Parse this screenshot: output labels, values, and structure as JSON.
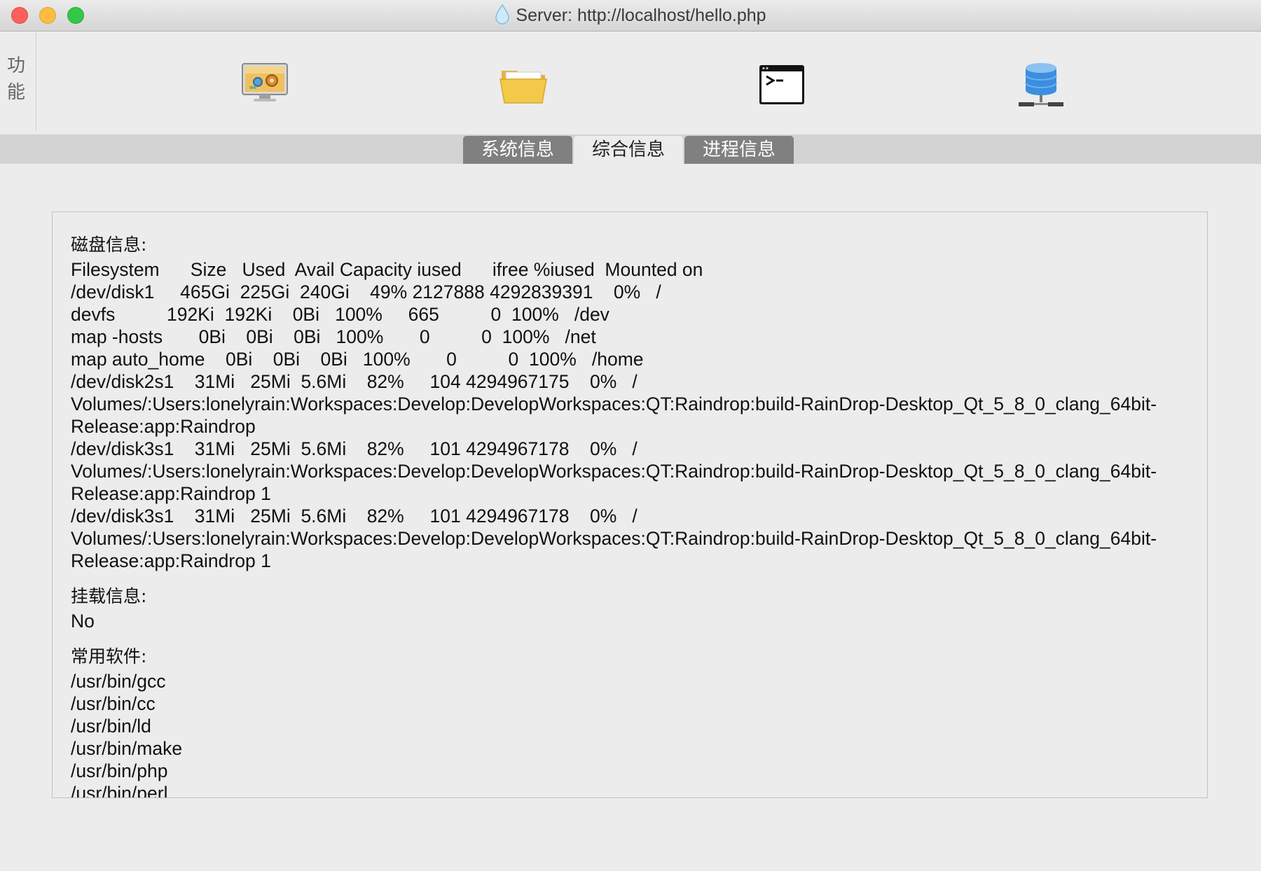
{
  "window": {
    "title": "Server: http://localhost/hello.php"
  },
  "toolbar": {
    "side_label": "功能",
    "tools": [
      {
        "name": "system-monitor-icon"
      },
      {
        "name": "folder-icon"
      },
      {
        "name": "terminal-icon"
      },
      {
        "name": "database-icon"
      }
    ]
  },
  "tabs": [
    {
      "label": "系统信息",
      "active": false
    },
    {
      "label": "综合信息",
      "active": true
    },
    {
      "label": "进程信息",
      "active": false
    }
  ],
  "content": {
    "disk_title": "磁盘信息:",
    "disk_lines": [
      "Filesystem      Size   Used  Avail Capacity iused      ifree %iused  Mounted on",
      "/dev/disk1     465Gi  225Gi  240Gi    49% 2127888 4292839391    0%   /",
      "devfs          192Ki  192Ki    0Bi   100%     665          0  100%   /dev",
      "map -hosts       0Bi    0Bi    0Bi   100%       0          0  100%   /net",
      "map auto_home    0Bi    0Bi    0Bi   100%       0          0  100%   /home",
      "/dev/disk2s1    31Mi   25Mi  5.6Mi    82%     104 4294967175    0%   /",
      "Volumes/:Users:lonelyrain:Workspaces:Develop:DevelopWorkspaces:QT:Raindrop:build-RainDrop-Desktop_Qt_5_8_0_clang_64bit-",
      "Release:app:Raindrop",
      "/dev/disk3s1    31Mi   25Mi  5.6Mi    82%     101 4294967178    0%   /",
      "Volumes/:Users:lonelyrain:Workspaces:Develop:DevelopWorkspaces:QT:Raindrop:build-RainDrop-Desktop_Qt_5_8_0_clang_64bit-",
      "Release:app:Raindrop 1",
      "/dev/disk3s1    31Mi   25Mi  5.6Mi    82%     101 4294967178    0%   /",
      "Volumes/:Users:lonelyrain:Workspaces:Develop:DevelopWorkspaces:QT:Raindrop:build-RainDrop-Desktop_Qt_5_8_0_clang_64bit-",
      "Release:app:Raindrop 1"
    ],
    "mount_title": "挂载信息:",
    "mount_value": "No",
    "software_title": "常用软件:",
    "software": [
      "/usr/bin/gcc",
      "/usr/bin/cc",
      "/usr/bin/ld",
      "/usr/bin/make",
      "/usr/bin/php",
      "/usr/bin/perl"
    ]
  }
}
